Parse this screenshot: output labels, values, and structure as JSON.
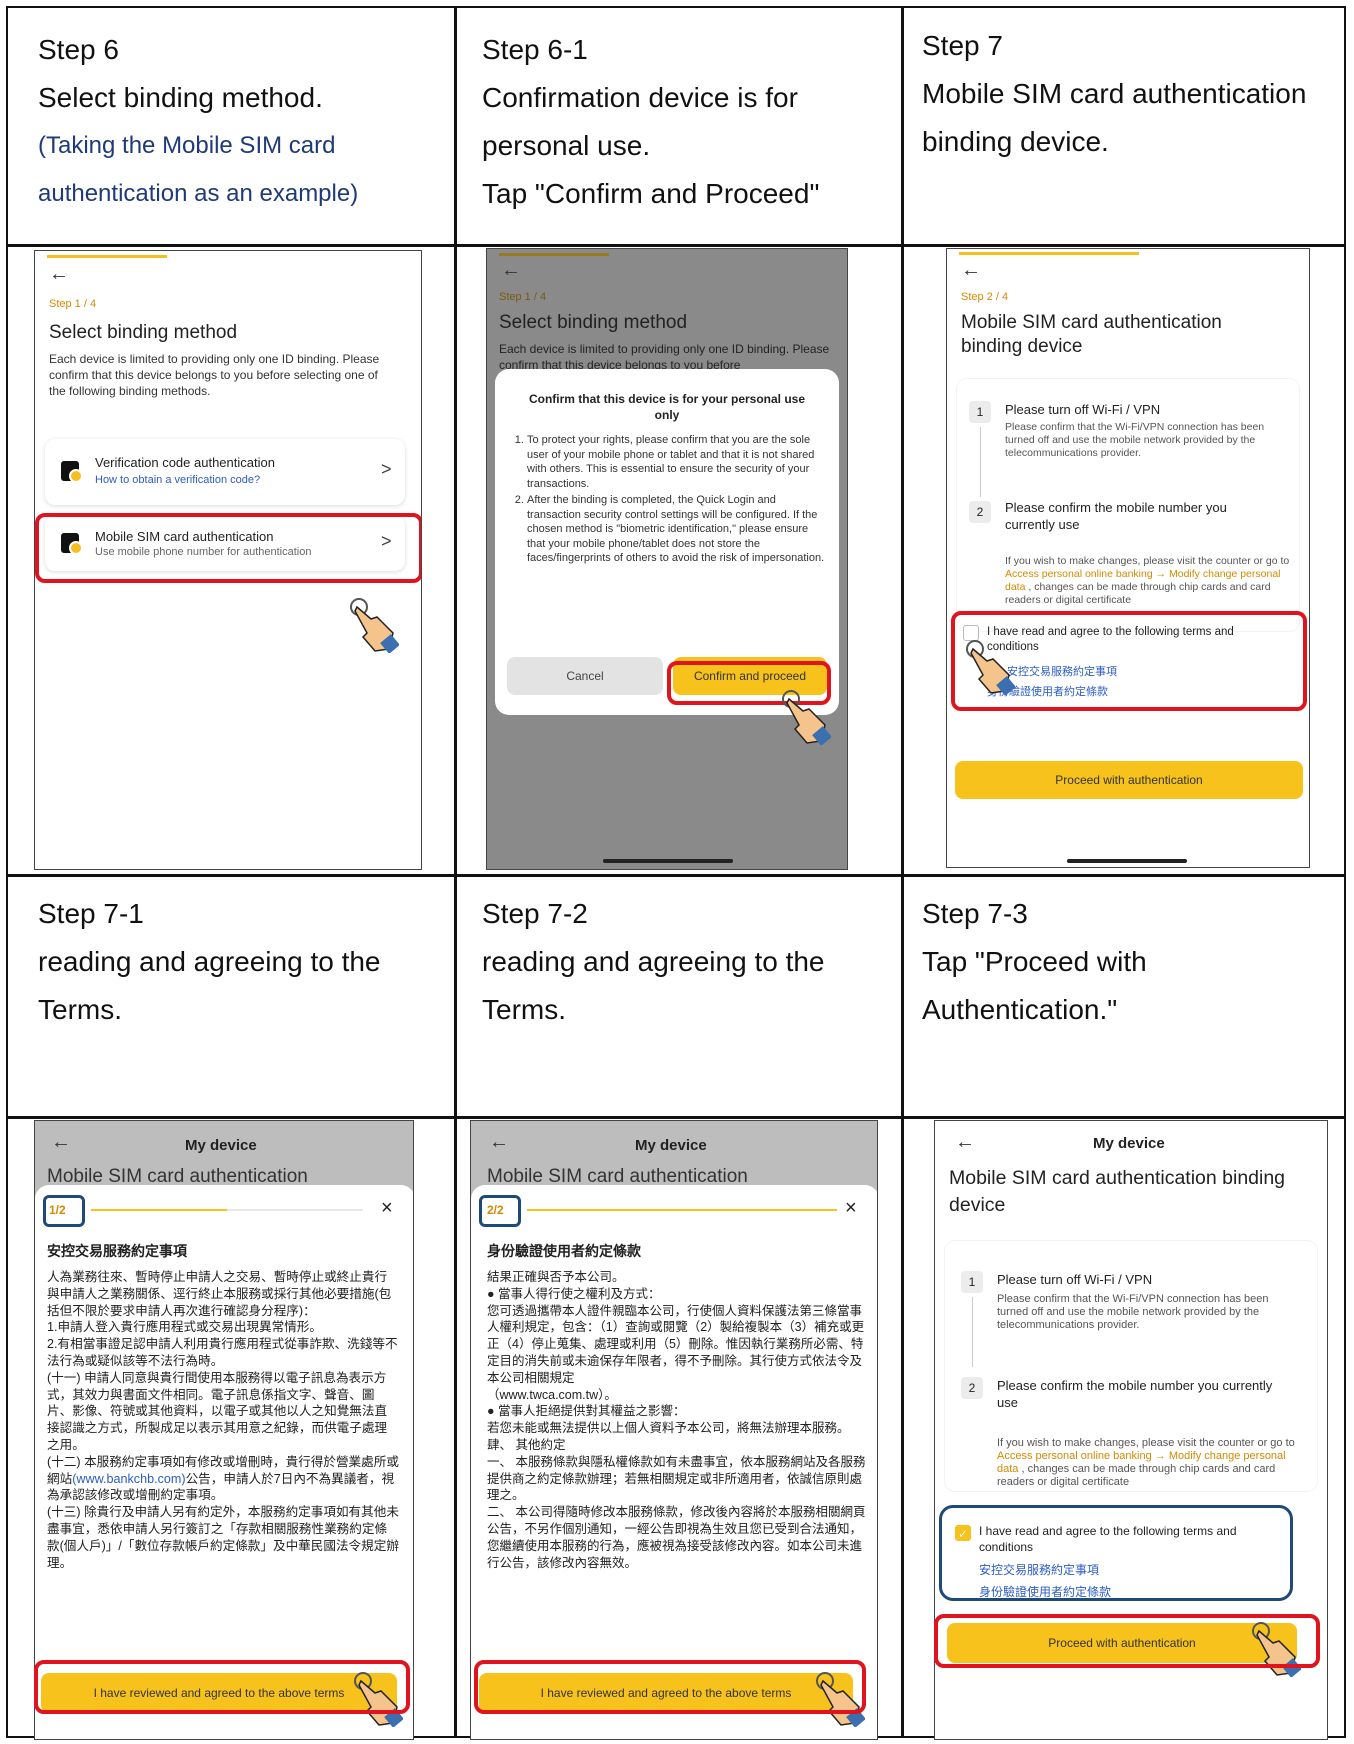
{
  "captions": {
    "c1": {
      "step": "Step 6",
      "line1": "Select binding method.",
      "note1": "(Taking the Mobile SIM card",
      "note2": "authentication as an example)"
    },
    "c2": {
      "step": "Step 6-1",
      "line1": "Confirmation device is for",
      "line2": "personal use.",
      "line3": "Tap \"Confirm and Proceed\""
    },
    "c3": {
      "step": "Step 7",
      "line1": "Mobile SIM card authentication",
      "line2": "binding device."
    },
    "c4": {
      "step": "Step 7-1",
      "line1": "reading and agreeing to the",
      "line2": "Terms."
    },
    "c5": {
      "step": "Step 7-2",
      "line1": "reading and agreeing to the",
      "line2": "Terms."
    },
    "c6": {
      "step": "Step 7-3",
      "line1": "Tap \"Proceed with",
      "line2": "Authentication.\""
    }
  },
  "screen1": {
    "back": "←",
    "step": "Step 1 / 4",
    "title": "Select binding method",
    "desc": "Each device is limited to providing only one ID binding. Please confirm that this device belongs to you before selecting one of the following binding methods.",
    "opt1": {
      "name": "Verification code authentication",
      "sub": "How to obtain a verification code?",
      "icon": "lock-phone-icon"
    },
    "opt2": {
      "name": "Mobile SIM card authentication",
      "sub": "Use mobile phone number for authentication",
      "icon": "sim-card-icon"
    },
    "chevron": ">"
  },
  "screen2": {
    "back": "←",
    "step": "Step 1 / 4",
    "title": "Select binding method",
    "desc": "Each device is limited to providing only one ID binding. Please confirm that this device belongs to you before",
    "modal_title": "Confirm that this device is for your personal use only",
    "item1": "To protect your rights, please confirm that you are the sole user of your mobile phone or tablet and that it is not shared with others. This is essential to ensure the security of your transactions.",
    "item2": "After the binding is completed, the Quick Login and transaction security control settings will be configured. If the chosen method is \"biometric identification,\" please ensure that your mobile phone/tablet does not store the faces/fingerprints of others to avoid the risk of impersonation.",
    "cancel": "Cancel",
    "confirm": "Confirm and proceed"
  },
  "screen3": {
    "back": "←",
    "step": "Step 2 / 4",
    "title": "Mobile SIM card authentication binding device",
    "s1num": "1",
    "s1head": "Please turn off Wi-Fi / VPN",
    "s1body": "Please confirm that the Wi-Fi/VPN connection has been turned off and use the mobile network provided by the telecommunications provider.",
    "s2num": "2",
    "s2head": "Please confirm the mobile number you currently use",
    "s2pre": "If you wish to make changes, please visit the counter or go to ",
    "s2link": "Access personal online banking → Modify change personal data",
    "s2post": " , changes can be made through chip cards and card readers or digital certificate",
    "agree": "I have read and agree to the following terms and conditions",
    "term1": "安控交易服務約定事項",
    "term2": "身份驗證使用者約定條款",
    "button": "Proceed with authentication"
  },
  "screen4": {
    "back": "←",
    "nav": "My device",
    "under": "Mobile SIM card authentication",
    "page": "1/2",
    "close": "×",
    "progress": 0.5,
    "heading": "安控交易服務約定事項",
    "text_a": "人為業務往來、暫時停止申請人之交易、暫時停止或終止貴行與申請人之業務關係、逕行終止本服務或採行其他必要措施(包括但不限於要求申請人再次進行確認身分程序)：\n1.申請人登入貴行應用程式或交易出現異常情形。\n2.有相當事證足認申請人利用貴行應用程式從事詐欺、洗錢等不法行為或疑似該等不法行為時。\n(十一) 申請人同意與貴行間使用本服務得以電子訊息為表示方式，其效力與書面文件相同。電子訊息係指文字、聲音、圖片、影像、符號或其他資料，以電子或其他以人之知覺無法直接認識之方式，所製成足以表示其用意之紀錄，而供電子處理之用。\n(十二) 本服務約定事項如有修改或增刪時，貴行得於營業處所或網站",
    "link": "(www.bankchb.com)",
    "text_b": "公告，申請人於7日內不為異議者，視為承認該修改或增刪約定事項。\n(十三) 除貴行及申請人另有約定外，本服務約定事項如有其他未盡事宜，悉依申請人另行簽訂之「存款相關服務性業務約定條款(個人戶)」/「數位存款帳戶約定條款」及中華民國法令規定辦理。",
    "button": "I have reviewed and agreed to the above terms"
  },
  "screen5": {
    "back": "←",
    "nav": "My device",
    "under": "Mobile SIM card authentication",
    "page": "2/2",
    "close": "×",
    "progress": 1,
    "heading": "身份驗證使用者約定條款",
    "text": "結果正確與否予本公司。\n● 當事人得行使之權利及方式：\n您可透過攜帶本人證件親臨本公司，行使個人資料保護法第三條當事人權利規定，包含：（1）查詢或閱覽（2）製給複製本（3）補充或更正（4）停止蒐集、處理或利用（5）刪除。惟因執行業務所必需、特定目的消失前或未逾保存年限者，得不予刪除。其行使方式依法令及本公司相關規定\n（www.twca.com.tw）。\n● 當事人拒絕提供對其權益之影響：\n若您未能或無法提供以上個人資料予本公司，將無法辦理本服務。\n肆、 其他約定\n一、 本服務條款與隱私權條款如有未盡事宜，依本服務網站及各服務提供商之約定條款辦理；若無相關規定或非所適用者，依誠信原則處理之。\n二、 本公司得隨時修改本服務條款，修改後內容將於本服務相關網頁公告，不另作個別通知，一經公告即視為生效且您已受到合法通知，您繼續使用本服務的行為，應被視為接受該修改內容。如本公司未進行公告，該修改內容無效。",
    "button": "I have reviewed and agreed to the above terms"
  },
  "screen6": {
    "back": "←",
    "nav": "My device",
    "title": "Mobile SIM card authentication binding device",
    "s1num": "1",
    "s1head": "Please turn off Wi-Fi / VPN",
    "s1body": "Please confirm that the Wi-Fi/VPN connection has been turned off and use the mobile network provided by the telecommunications provider.",
    "s2num": "2",
    "s2head": "Please confirm the mobile number you currently use",
    "s2pre": "If you wish to make changes, please visit the counter or go to ",
    "s2link": "Access personal online banking → Modify change personal data",
    "s2post": " , changes can be made through chip cards and card readers or digital certificate",
    "check": "✓",
    "agree": "I have read and agree to the following terms and conditions",
    "term1": "安控交易服務約定事項",
    "term2": "身份驗證使用者約定條款",
    "button": "Proceed with authentication"
  },
  "colors": {
    "accent": "#f6c21b",
    "highlight": "#e0141e",
    "navy": "#1e4a7a",
    "link": "#2c5cc5",
    "step": "#d48a00"
  }
}
